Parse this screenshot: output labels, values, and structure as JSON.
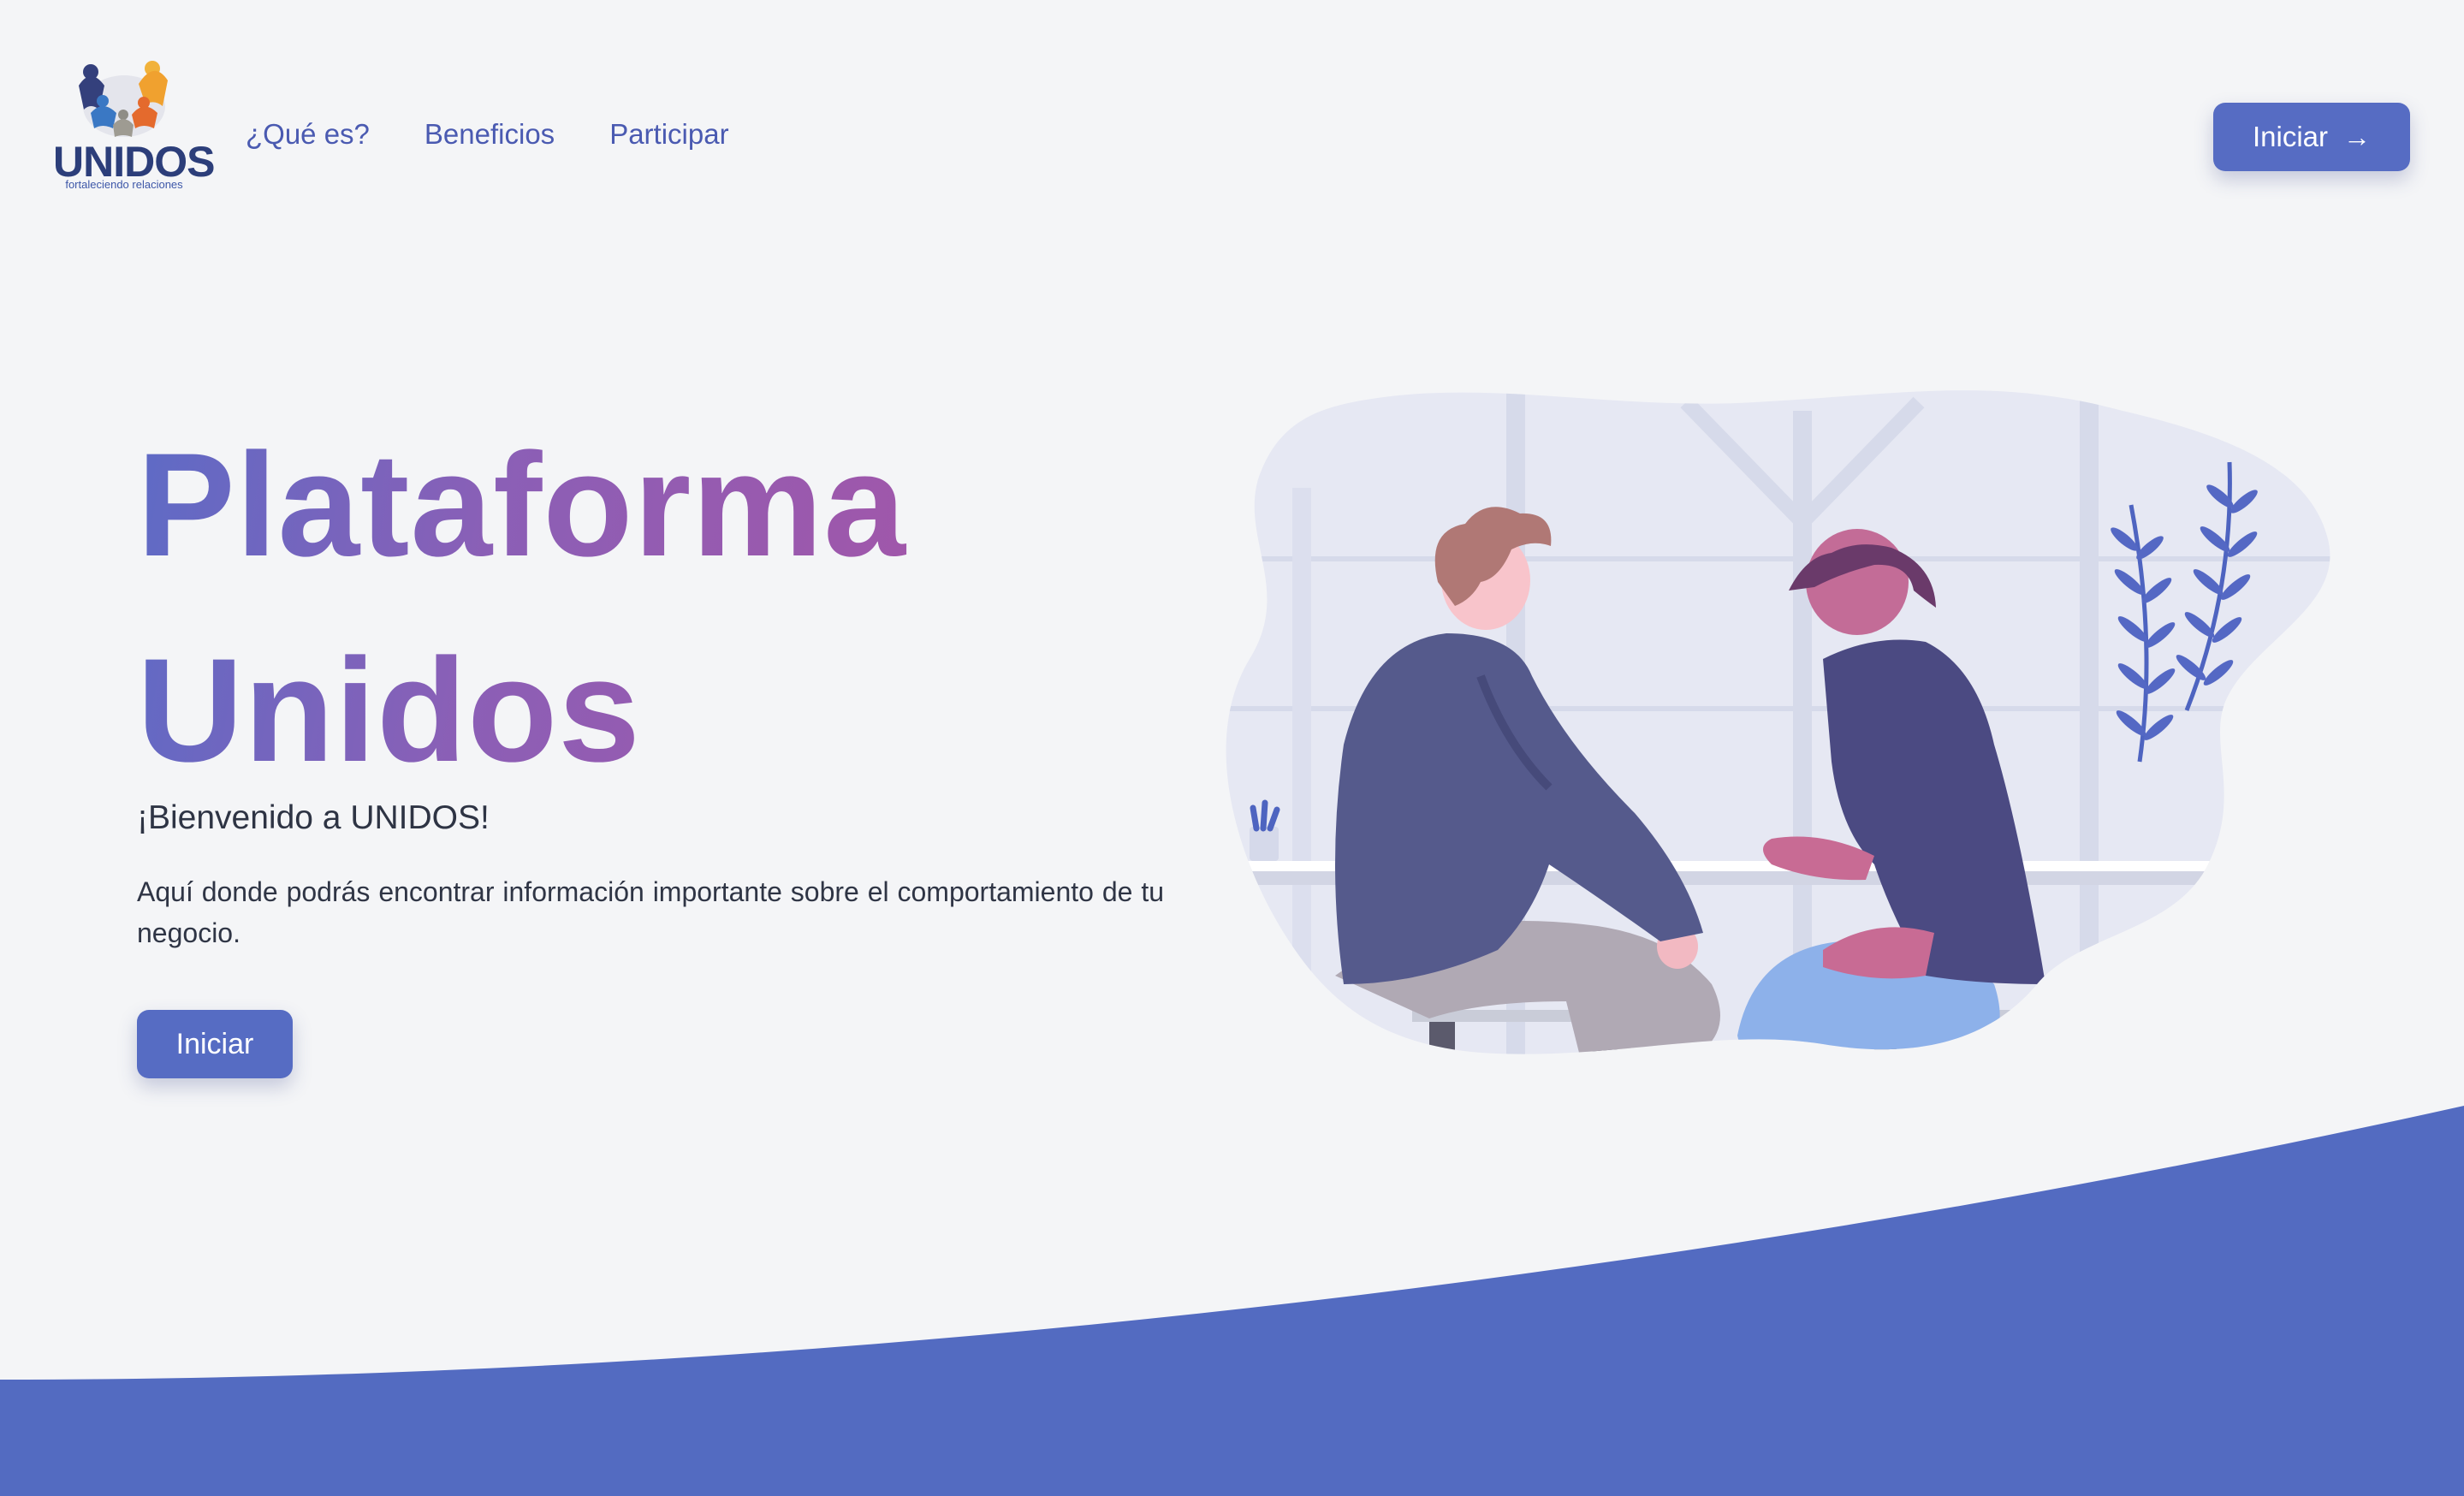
{
  "logo": {
    "word": "UNIDOS",
    "tagline": "fortaleciendo relaciones",
    "icon": "people-circle-logo-icon"
  },
  "nav": {
    "items": [
      {
        "label": "¿Qué es?"
      },
      {
        "label": "Beneficios"
      },
      {
        "label": "Participar"
      }
    ]
  },
  "header_button": {
    "label": "Iniciar",
    "icon": "arrow-right-icon"
  },
  "hero": {
    "title_line1": "Plataforma",
    "title_line2": "Unidos",
    "welcome": "¡Bienvenido a UNIDOS!",
    "description": "Aquí donde podrás encontrar información importante sobre el comportamiento de tu negocio.",
    "button_label": "Iniciar"
  },
  "colors": {
    "accent": "#566cc3",
    "nav_text": "#4a5ab1",
    "background": "#f4f5f7",
    "gradient_start": "#5d6bc6",
    "gradient_end": "#a256a9"
  }
}
